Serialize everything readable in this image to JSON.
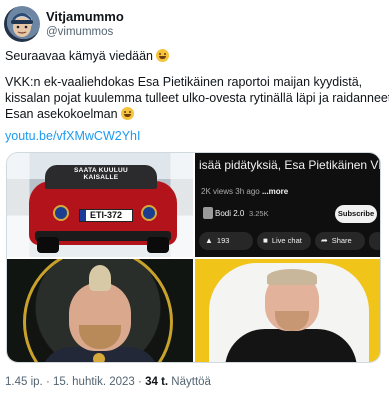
{
  "author": {
    "display_name": "Vitjamummo",
    "handle": "@vimummos"
  },
  "tweet": {
    "line1": "Seuraavaa kämyä viedään",
    "line2": "VKK:n ek-vaaliehdokas Esa Pietikäinen raportoi maijan kyydistä,",
    "line3": "kissalan pojat kuulemma tulleet ulko-ovesta rytinällä läpi ja raidanneet",
    "line4": "Esan asekokoelman",
    "link": "youtu.be/vfXMwCW2YhI"
  },
  "media": {
    "car": {
      "roof_sign": "SAATA KUULUU KAISALLE",
      "plate": "ETI-372"
    },
    "youtube": {
      "title": "isää pidätyksiä, Esa Pietikäinen VKK Mikkeli",
      "views": "2K views",
      "age": "3h ago",
      "more": "...more",
      "channel": "Bodi 2.0",
      "subscribers": "3.25K",
      "subscribe_label": "Subscribe",
      "likes": "193",
      "live_chat_label": "Live chat",
      "share_label": "Share"
    }
  },
  "meta": {
    "time": "1.45 ip.",
    "date": "15. huhtik. 2023",
    "views_count": "34 t.",
    "views_label": "Näyttöä"
  },
  "colors": {
    "link": "#1d9bf0",
    "secondary_text": "#536471",
    "accent_yellow": "#f0c419"
  }
}
